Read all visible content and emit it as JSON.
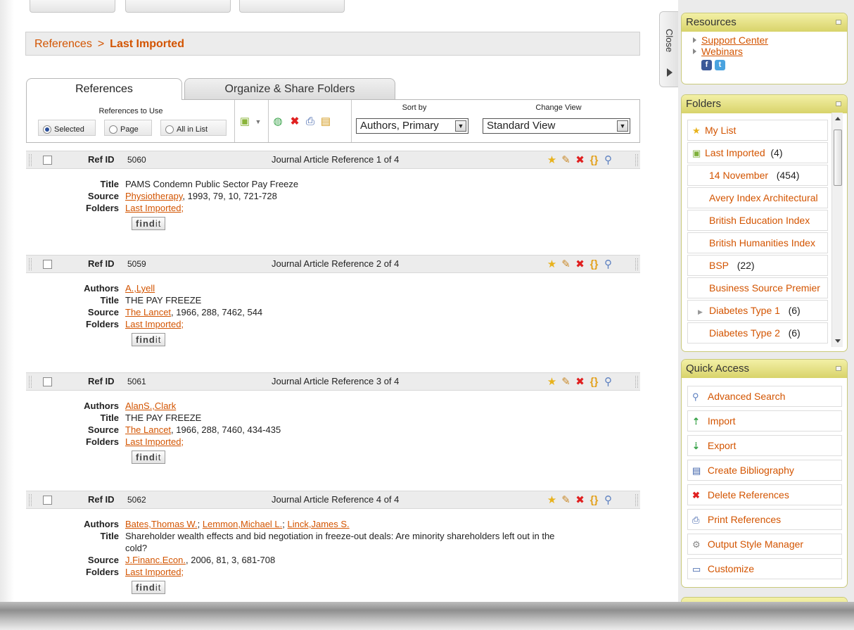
{
  "breadcrumb": {
    "root": "References",
    "separator": ">",
    "current": "Last Imported"
  },
  "tabs": [
    {
      "label": "References"
    },
    {
      "label": "Organize & Share Folders"
    }
  ],
  "toolbar": {
    "references_to_use_label": "References to Use",
    "options": [
      {
        "label": "Selected",
        "checked": true
      },
      {
        "label": "Page",
        "checked": false
      },
      {
        "label": "All in List",
        "checked": false
      }
    ],
    "sort_by_label": "Sort by",
    "sort_value": "Authors, Primary",
    "change_view_label": "Change View",
    "view_value": "Standard View"
  },
  "labels": {
    "ref_id": "Ref ID",
    "authors": "Authors",
    "title": "Title",
    "source": "Source",
    "folders": "Folders",
    "findit_a": "find",
    "findit_b": "it"
  },
  "references": [
    {
      "ref_id": "5060",
      "desc": "Journal Article Reference 1 of 4",
      "authors": [],
      "title": "PAMS Condemn Public Sector Pay Freeze",
      "source_link": "Physiotherapy",
      "source_rest": ", 1993, 79, 10, 721-728",
      "folder_link": "Last Imported",
      "folder_rest": ";"
    },
    {
      "ref_id": "5059",
      "desc": "Journal Article Reference 2 of 4",
      "authors": [
        "A.,Lyell"
      ],
      "title": "THE PAY FREEZE",
      "source_link": "The Lancet",
      "source_rest": ", 1966, 288, 7462, 544",
      "folder_link": "Last Imported",
      "folder_rest": ";"
    },
    {
      "ref_id": "5061",
      "desc": "Journal Article Reference 3 of 4",
      "authors": [
        "AlanS.,Clark"
      ],
      "title": "THE PAY FREEZE",
      "source_link": "The Lancet",
      "source_rest": ", 1966, 288, 7460, 434-435",
      "folder_link": "Last Imported",
      "folder_rest": ";"
    },
    {
      "ref_id": "5062",
      "desc": "Journal Article Reference 4 of 4",
      "authors": [
        "Bates,Thomas W.",
        "Lemmon,Michael L.",
        "Linck,James S."
      ],
      "author_sep": "; ",
      "title_line1": "Shareholder wealth effects and bid negotiation in freeze-out deals: Are minority shareholders left out in the",
      "title_line2": "cold?",
      "source_link": "J.Financ.Econ.",
      "source_rest": ", 2006, 81, 3, 681-708",
      "folder_link": "Last Imported",
      "folder_rest": ";"
    }
  ],
  "close_tab": {
    "label": "Close"
  },
  "resources": {
    "title": "Resources",
    "items": [
      "Support Center",
      "Webinars"
    ],
    "facebook": "f",
    "twitter": "t"
  },
  "folders": {
    "title": "Folders",
    "items": [
      {
        "label": "My List",
        "count": "",
        "icon": "star-icon"
      },
      {
        "label": "Last Imported",
        "count": "(4)",
        "icon": "folder-icon"
      },
      {
        "label": "14 November",
        "count": "(454)"
      },
      {
        "label": "Avery Index Architectural",
        "count": ""
      },
      {
        "label": "British Education Index",
        "count": ""
      },
      {
        "label": "British Humanities Index",
        "count": ""
      },
      {
        "label": "BSP",
        "count": "(22)"
      },
      {
        "label": "Business Source Premier",
        "count": ""
      },
      {
        "label": "Diabetes Type 1",
        "count": "(6)",
        "expandable": true
      },
      {
        "label": "Diabetes Type 2",
        "count": "(6)"
      }
    ]
  },
  "quick_access": {
    "title": "Quick Access",
    "items": [
      {
        "label": "Advanced Search",
        "icon": "magnifier-icon"
      },
      {
        "label": "Import",
        "icon": "up-arrow-icon"
      },
      {
        "label": "Export",
        "icon": "down-arrow-icon"
      },
      {
        "label": "Create Bibliography",
        "icon": "bibliography-icon"
      },
      {
        "label": "Delete References",
        "icon": "delete-x-icon"
      },
      {
        "label": "Print References",
        "icon": "printer-icon"
      },
      {
        "label": "Output Style Manager",
        "icon": "gear-icon"
      },
      {
        "label": "Customize",
        "icon": "window-icon"
      }
    ]
  },
  "colors": {
    "accent": "#d35400",
    "panel_header": "#e4df82"
  }
}
